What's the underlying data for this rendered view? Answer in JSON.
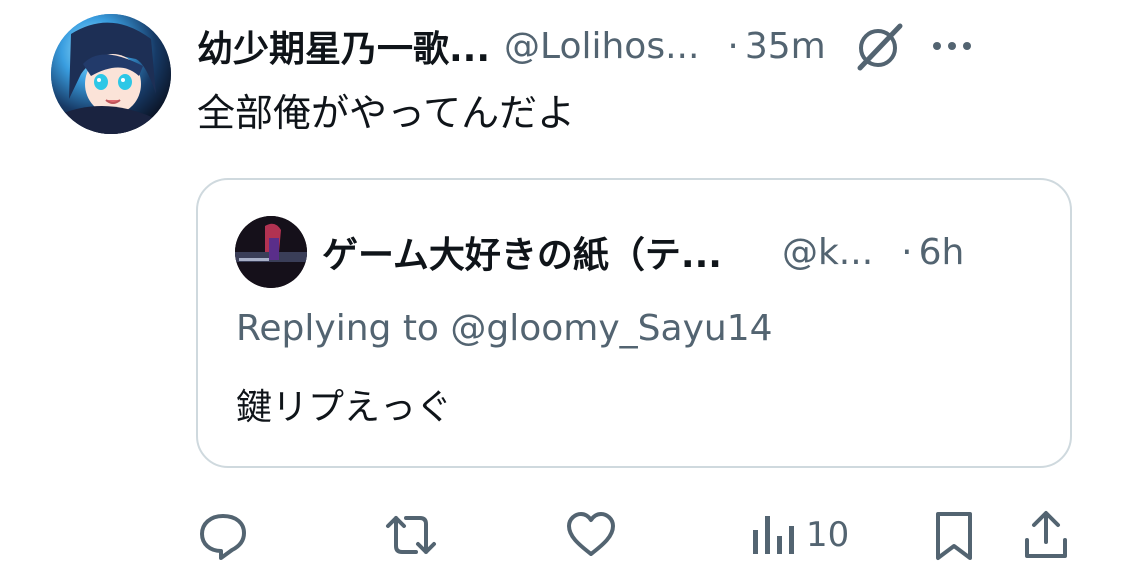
{
  "tweet": {
    "author_name": "幼少期星乃一歌...",
    "author_handle": "@Lolihos...",
    "time_separator": "·",
    "time": "35m",
    "text": "全部俺がやってんだよ"
  },
  "quoted": {
    "author_name": "ゲーム大好きの紙（テ...",
    "author_handle": "@k...",
    "time_separator": "·",
    "time": "6h",
    "replying_to": "Replying to @gloomy_Sayu14",
    "text": "鍵リプえっぐ"
  },
  "actions": {
    "views_count": "10"
  },
  "icons": {
    "grok": "grok-icon",
    "more": "more-icon",
    "reply": "reply-icon",
    "retweet": "retweet-icon",
    "like": "like-icon",
    "views": "views-icon",
    "bookmark": "bookmark-icon",
    "share": "share-icon"
  },
  "colors": {
    "text_primary": "#0f1419",
    "text_secondary": "#536471",
    "border": "#cfd9de"
  }
}
